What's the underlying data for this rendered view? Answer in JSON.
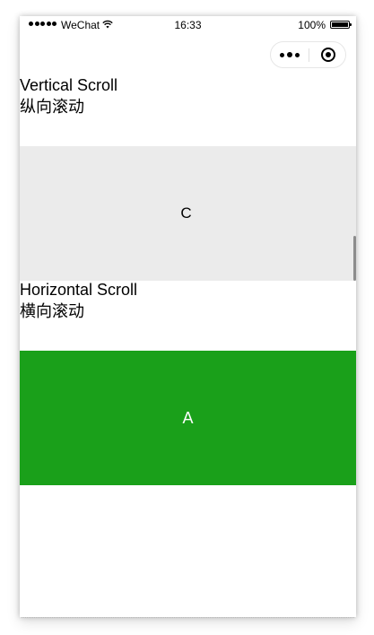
{
  "status_bar": {
    "carrier": "WeChat",
    "time": "16:33",
    "battery_percent": "100%",
    "signal_icon": "signal-dots-icon",
    "wifi_icon": "wifi-icon",
    "battery_icon": "battery-icon"
  },
  "capsule": {
    "more_icon": "more-dots-icon",
    "close_icon": "target-close-icon"
  },
  "vertical_section": {
    "title": "Vertical Scroll",
    "subtitle": "纵向滚动",
    "current_item": "C",
    "background": "#ebebeb"
  },
  "horizontal_section": {
    "title": "Horizontal Scroll",
    "subtitle": "横向滚动",
    "current_item": "A",
    "background": "#1aa01a"
  }
}
